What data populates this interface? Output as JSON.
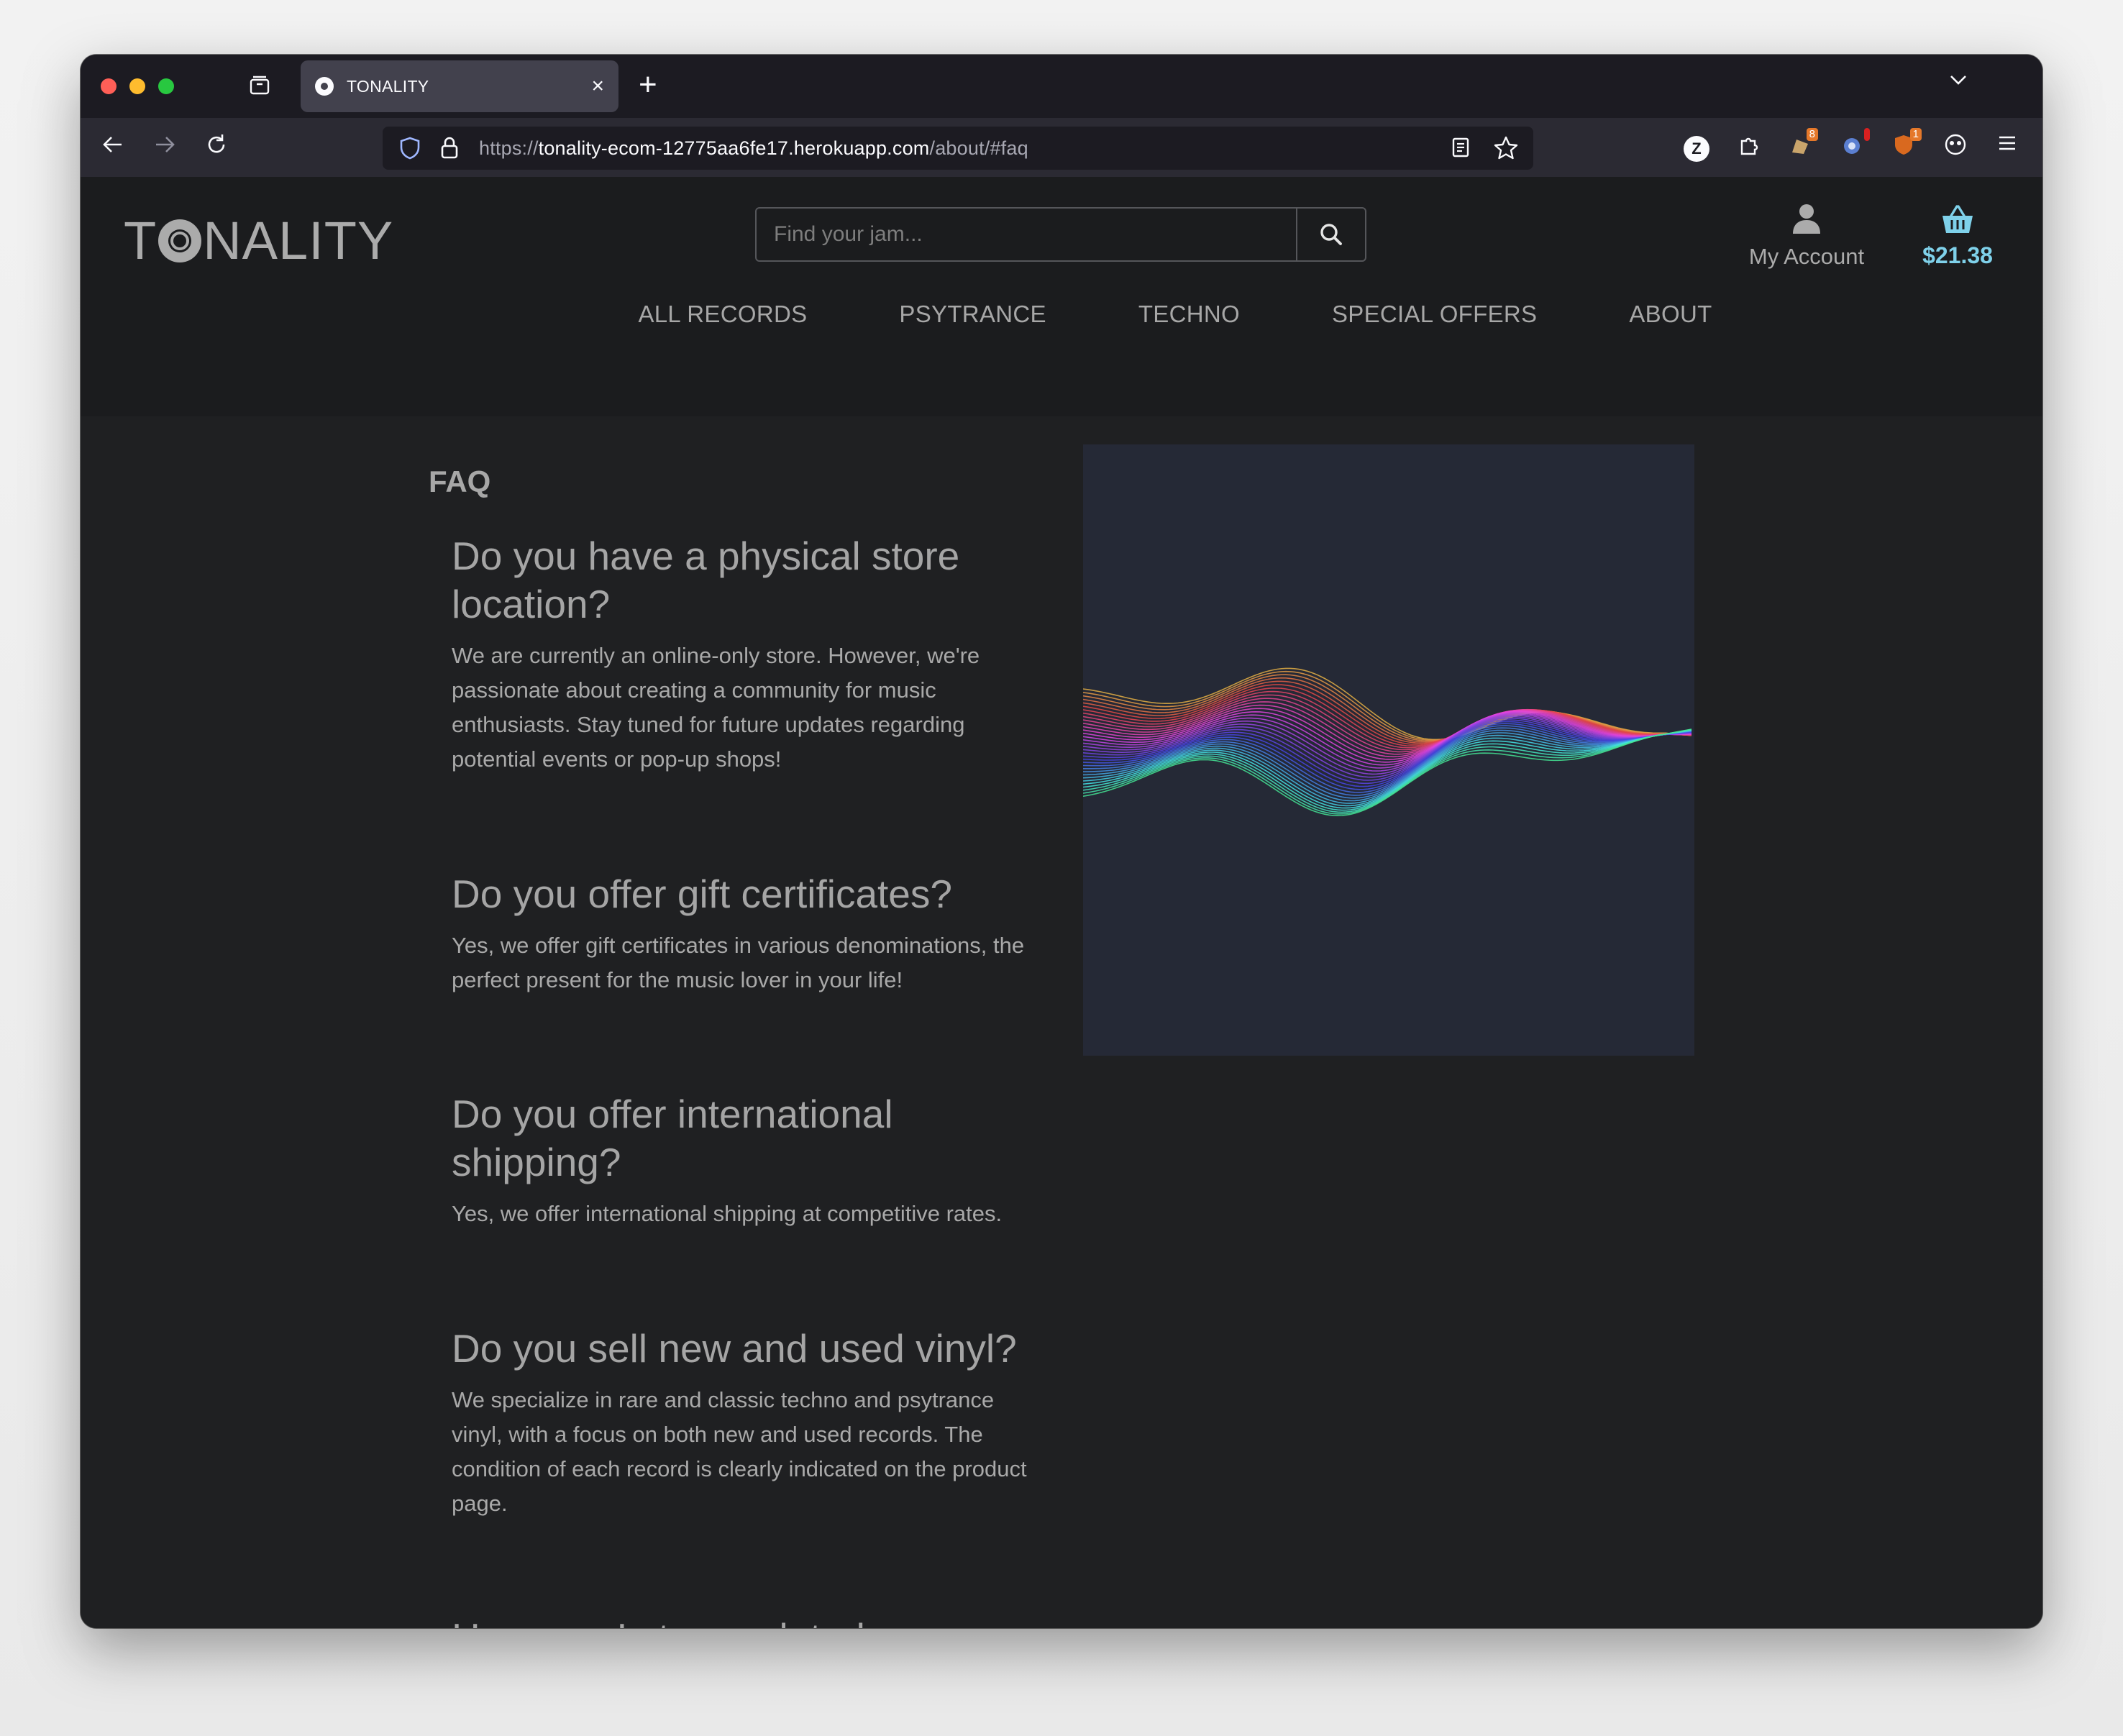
{
  "browser": {
    "tab_title": "TONALITY",
    "url_prefix": "https://",
    "url_host": "tonality-ecom-12775aa6fe17.herokuapp.com",
    "url_path": "/about/#faq",
    "extension_badges": [
      "8",
      "",
      "1"
    ]
  },
  "site": {
    "logo_prefix": "T",
    "logo_suffix": "NALITY",
    "search_placeholder": "Find your jam...",
    "account_label": "My Account",
    "cart_total": "$21.38",
    "nav": [
      "ALL RECORDS",
      "PSYTRANCE",
      "TECHNO",
      "SPECIAL OFFERS",
      "ABOUT"
    ],
    "colors": {
      "accent": "#7fd1ea",
      "text": "#a7a7a7",
      "background": "#1f2022"
    }
  },
  "faq": {
    "heading": "FAQ",
    "items": [
      {
        "question": "Do you have a physical store location?",
        "answer": "We are currently an online-only store. However, we're passionate about creating a community for music enthusiasts. Stay tuned for future updates regarding potential events or pop-up shops!"
      },
      {
        "question": "Do you offer gift certificates?",
        "answer": "Yes, we offer gift certificates in various denominations, the perfect present for the music lover in your life!"
      },
      {
        "question": "Do you offer international shipping?",
        "answer": "Yes, we offer international shipping at competitive rates."
      },
      {
        "question": "Do you sell new and used vinyl?",
        "answer": "We specialize in rare and classic techno and psytrance vinyl, with a focus on both new and used records. The condition of each record is clearly indicated on the product page."
      },
      {
        "question": "How can I stay updated on your latest arrivals and promotions?",
        "answer": ""
      }
    ]
  }
}
